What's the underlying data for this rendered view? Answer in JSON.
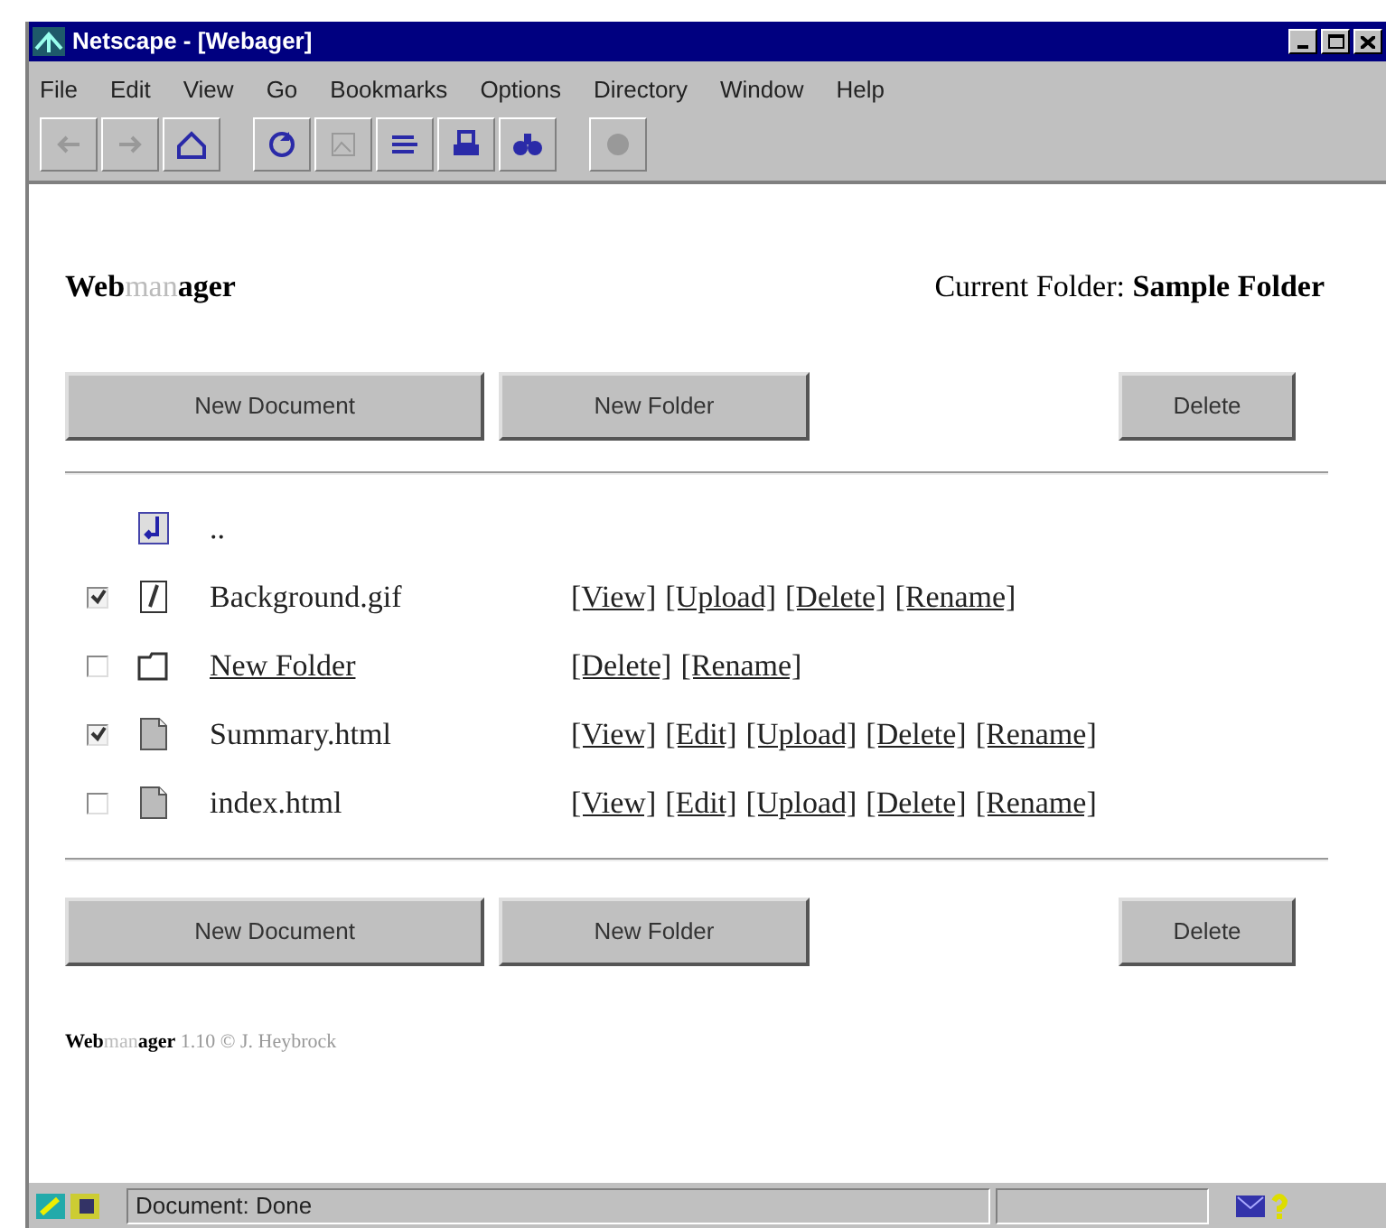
{
  "window": {
    "title": "Netscape - [Webager]"
  },
  "menu": [
    {
      "label": "File"
    },
    {
      "label": "Edit"
    },
    {
      "label": "View"
    },
    {
      "label": "Go"
    },
    {
      "label": "Bookmarks"
    },
    {
      "label": "Options"
    },
    {
      "label": "Directory"
    },
    {
      "label": "Window"
    },
    {
      "label": "Help"
    }
  ],
  "toolbar": [
    {
      "kind": "back",
      "disabled": true
    },
    {
      "kind": "forward",
      "disabled": true
    },
    {
      "kind": "home",
      "disabled": false
    },
    {
      "kind": "sep"
    },
    {
      "kind": "reload",
      "disabled": false
    },
    {
      "kind": "images",
      "disabled": true
    },
    {
      "kind": "open",
      "disabled": false
    },
    {
      "kind": "print",
      "disabled": false
    },
    {
      "kind": "find",
      "disabled": false
    },
    {
      "kind": "sep"
    },
    {
      "kind": "stop",
      "disabled": true
    }
  ],
  "header": {
    "logo": [
      {
        "text": "Web",
        "faded": false
      },
      {
        "text": "man",
        "faded": true
      },
      {
        "text": "ager",
        "faded": false
      }
    ],
    "folder_label": "Current Folder:",
    "folder_name": "Sample Folder"
  },
  "top_buttons": [
    "New Document",
    "New Folder",
    "Delete"
  ],
  "files": [
    {
      "kind": "parent",
      "name": ".."
    },
    {
      "kind": "image",
      "name": "Background.gif",
      "checked": true,
      "actions": [
        "[View]",
        "[Upload]",
        "[Delete]",
        "[Rename]"
      ]
    },
    {
      "kind": "folder",
      "name": "New Folder",
      "checked": false,
      "actions": [
        "[Delete]",
        "[Rename]"
      ]
    },
    {
      "kind": "document",
      "name": "Summary.html",
      "checked": true,
      "actions": [
        "[View]",
        "[Edit]",
        "[Upload]",
        "[Delete]",
        "[Rename]"
      ]
    },
    {
      "kind": "document",
      "name": "index.html",
      "checked": false,
      "actions": [
        "[View]",
        "[Edit]",
        "[Upload]",
        "[Delete]",
        "[Rename]"
      ]
    }
  ],
  "bottom_buttons": [
    "New Document",
    "New Folder",
    "Delete"
  ],
  "footer": {
    "logo": [
      {
        "text": "Web",
        "faded": false
      },
      {
        "text": "man",
        "faded": true
      },
      {
        "text": "ager",
        "faded": false
      }
    ],
    "version": "1.10 © J. Heybrock"
  },
  "status_bar": {
    "text": "Document: Done"
  }
}
